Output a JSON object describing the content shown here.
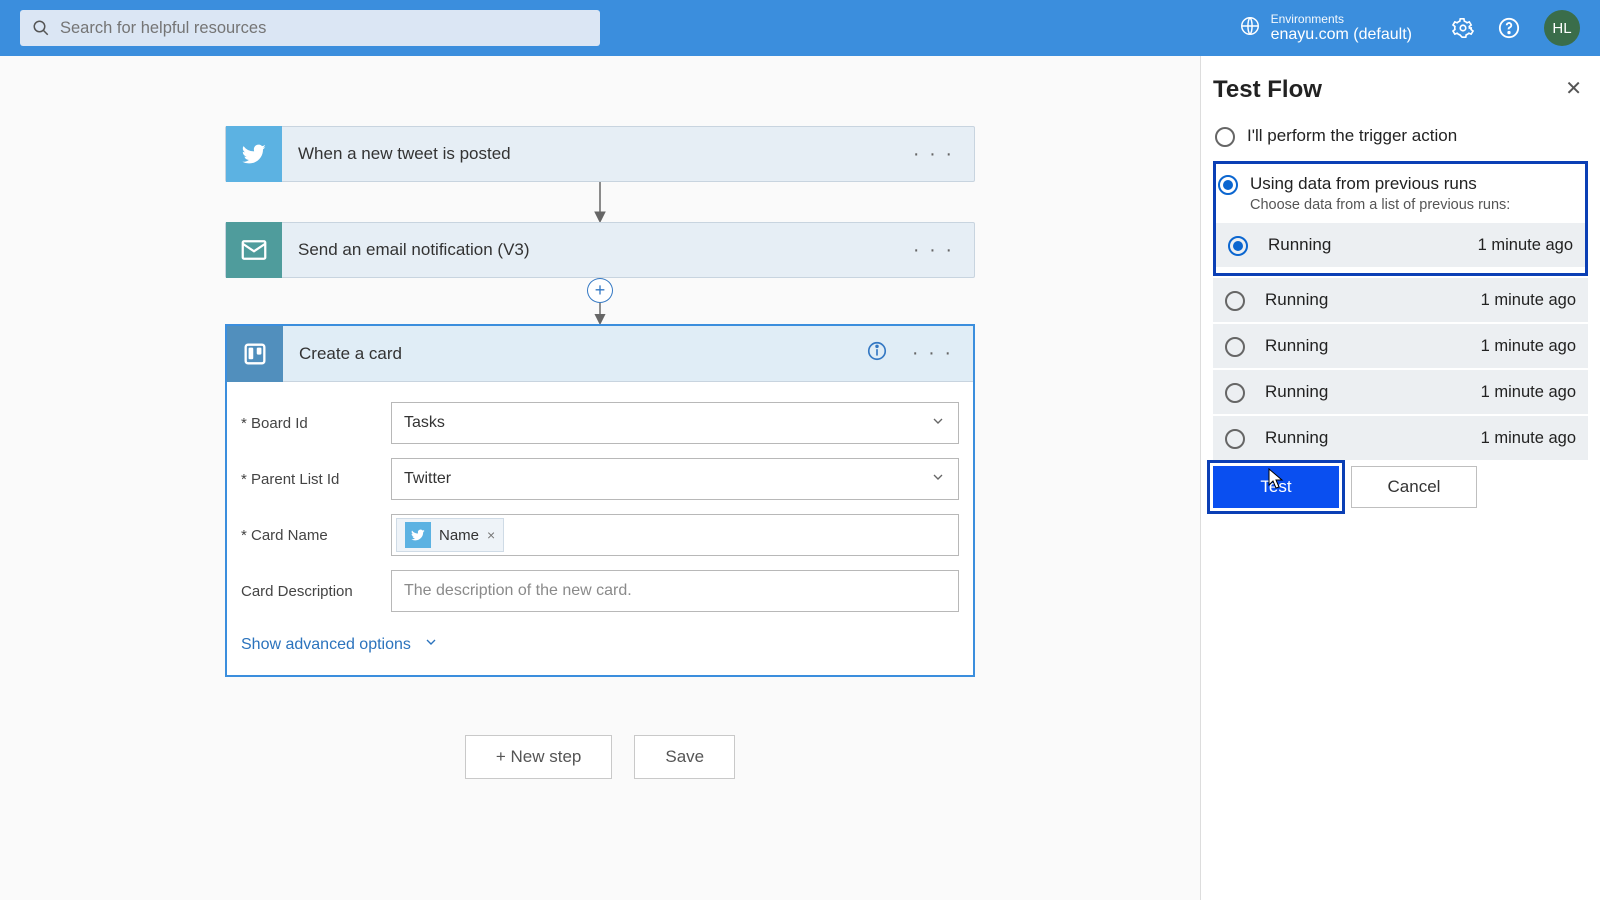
{
  "header": {
    "search_placeholder": "Search for helpful resources",
    "env_label": "Environments",
    "env_name": "enayu.com (default)",
    "avatar_initials": "HL"
  },
  "flow": {
    "trigger": {
      "title": "When a new tweet is posted"
    },
    "action_email": {
      "title": "Send an email notification (V3)"
    },
    "action_trello": {
      "title": "Create a card",
      "fields": {
        "board_label": "* Board Id",
        "board_value": "Tasks",
        "list_label": "* Parent List Id",
        "list_value": "Twitter",
        "name_label": "* Card Name",
        "name_token": "Name",
        "desc_label": "Card Description",
        "desc_placeholder": "The description of the new card."
      },
      "advanced": "Show advanced options"
    },
    "buttons": {
      "new_step": "+ New step",
      "save": "Save"
    }
  },
  "panel": {
    "title": "Test Flow",
    "option_manual": "I'll perform the trigger action",
    "option_previous": "Using data from previous runs",
    "option_previous_sub": "Choose data from a list of previous runs:",
    "runs": [
      {
        "status": "Running",
        "time": "1 minute ago",
        "selected": true
      },
      {
        "status": "Running",
        "time": "1 minute ago",
        "selected": false
      },
      {
        "status": "Running",
        "time": "1 minute ago",
        "selected": false
      },
      {
        "status": "Running",
        "time": "1 minute ago",
        "selected": false
      },
      {
        "status": "Running",
        "time": "1 minute ago",
        "selected": false
      }
    ],
    "test_btn": "Test",
    "cancel_btn": "Cancel"
  }
}
